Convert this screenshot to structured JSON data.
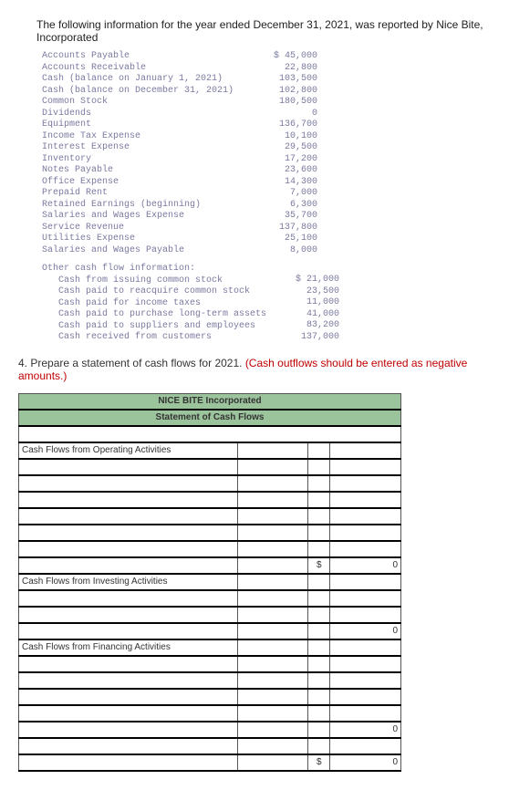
{
  "intro": "The following information for the year ended December 31, 2021, was reported by Nice Bite, Incorporated",
  "accounts": {
    "labels": "Accounts Payable\nAccounts Receivable\nCash (balance on January 1, 2021)\nCash (balance on December 31, 2021)\nCommon Stock\nDividends\nEquipment\nIncome Tax Expense\nInterest Expense\nInventory\nNotes Payable\nOffice Expense\nPrepaid Rent\nRetained Earnings (beginning)\nSalaries and Wages Expense\nService Revenue\nUtilities Expense\nSalaries and Wages Payable",
    "values": "$ 45,000\n22,800\n103,500\n102,800\n180,500\n0\n136,700\n10,100\n29,500\n17,200\n23,600\n14,300\n7,000\n6,300\n35,700\n137,800\n25,100\n8,000"
  },
  "other": {
    "head": "Other cash flow information:",
    "labels": "   Cash from issuing common stock\n   Cash paid to reacquire common stock\n   Cash paid for income taxes\n   Cash paid to purchase long-term assets\n   Cash paid to suppliers and employees\n   Cash received from customers",
    "values": "$ 21,000\n23,500\n11,000\n41,000\n83,200\n137,000"
  },
  "question": {
    "prefix": "4. Prepare a statement of cash flows for 2021. ",
    "red": "(Cash outflows should be entered as negative amounts.)"
  },
  "sheet": {
    "title1": "NICE BITE Incorporated",
    "title2": "Statement of Cash Flows",
    "sec1": "Cash Flows from Operating Activities",
    "sec2": "Cash Flows from Investing Activities",
    "sec3": "Cash Flows from Financing Activities",
    "dollar": "$",
    "zero": "0"
  }
}
